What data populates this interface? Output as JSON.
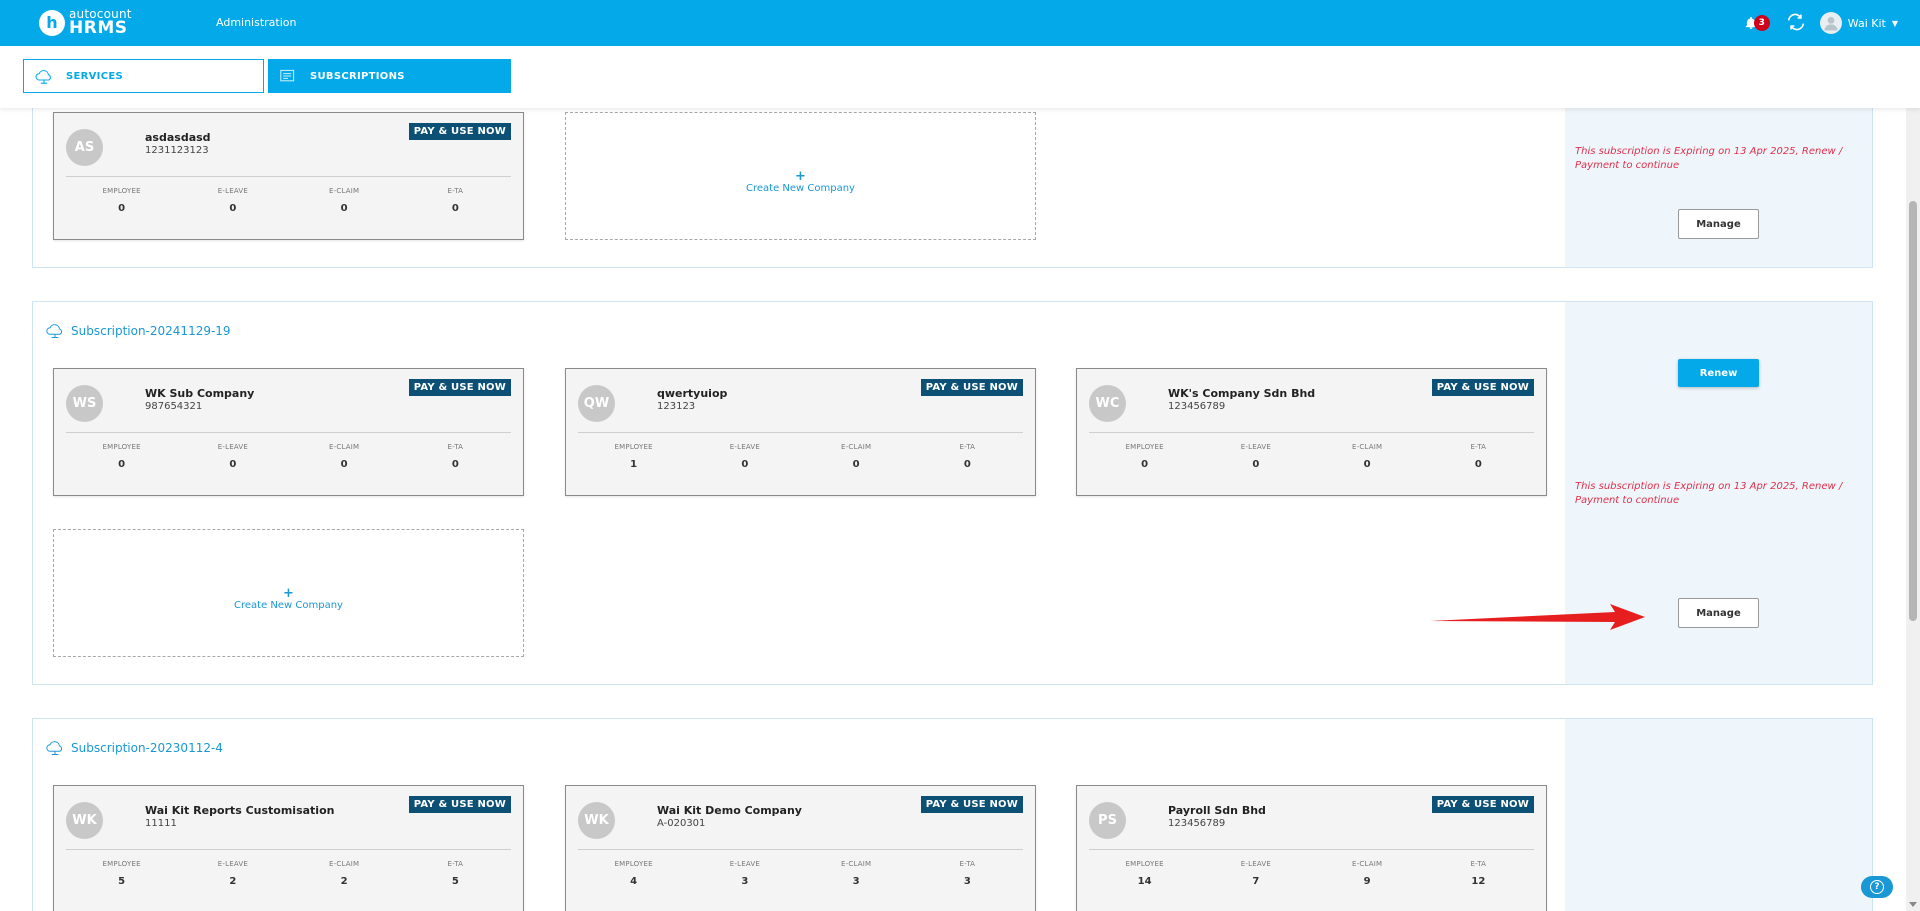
{
  "header": {
    "logo_letter": "h",
    "logo_sub": "autocount",
    "logo_main": "HRMS",
    "admin_label": "Administration",
    "notification_count": "3",
    "user_name": "Wai Kit"
  },
  "tabs": {
    "services": "SERVICES",
    "subscriptions": "SUBSCRIPTIONS"
  },
  "common": {
    "pay_label": "PAY & USE NOW",
    "stat_labels": [
      "EMPLOYEE",
      "E-LEAVE",
      "E-CLAIM",
      "E-TA"
    ],
    "create_plus": "+",
    "create_label": "Create New Company",
    "manage_label": "Manage",
    "renew_label": "Renew",
    "expire_text": "This subscription is Expiring on 13 Apr 2025, Renew / Payment to continue"
  },
  "subscriptions": [
    {
      "title": "",
      "companies": [
        {
          "initials": "AS",
          "name": "asdasdasd",
          "code": "1231123123",
          "stats": [
            "0",
            "0",
            "0",
            "0"
          ]
        }
      ]
    },
    {
      "title": "Subscription-20241129-19",
      "companies": [
        {
          "initials": "WS",
          "name": "WK Sub Company",
          "code": "987654321",
          "stats": [
            "0",
            "0",
            "0",
            "0"
          ]
        },
        {
          "initials": "QW",
          "name": "qwertyuiop",
          "code": "123123",
          "stats": [
            "1",
            "0",
            "0",
            "0"
          ]
        },
        {
          "initials": "WC",
          "name": "WK's Company Sdn Bhd",
          "code": "123456789",
          "stats": [
            "0",
            "0",
            "0",
            "0"
          ]
        }
      ]
    },
    {
      "title": "Subscription-20230112-4",
      "companies": [
        {
          "initials": "WK",
          "name": "Wai Kit Reports Customisation",
          "code": "11111",
          "stats": [
            "5",
            "2",
            "2",
            "5"
          ]
        },
        {
          "initials": "WK",
          "name": "Wai Kit Demo Company",
          "code": "A-020301",
          "stats": [
            "4",
            "3",
            "3",
            "3"
          ]
        },
        {
          "initials": "PS",
          "name": "Payroll Sdn Bhd",
          "code": "123456789",
          "stats": [
            "14",
            "7",
            "9",
            "12"
          ]
        }
      ]
    }
  ],
  "colors": {
    "primary": "#03a9e8",
    "pay_badge": "#0c5175",
    "expire_text": "#e0304a",
    "side_panel": "#eef6fc"
  },
  "icons": [
    "bell-icon",
    "swap-icon",
    "avatar-icon",
    "chevron-down-icon",
    "cloud-icon",
    "subscription-icon",
    "help-icon",
    "arrow-annotation"
  ]
}
